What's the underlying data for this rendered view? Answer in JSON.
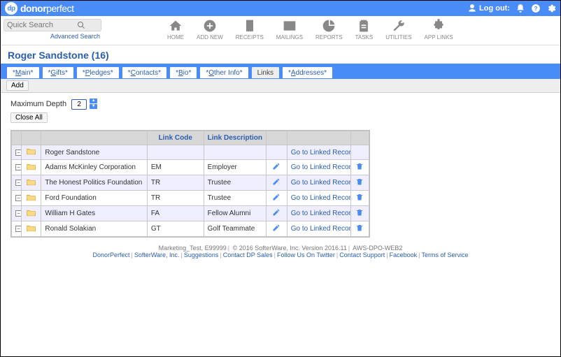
{
  "brand": {
    "badge": "dp",
    "name_part1": "donor",
    "name_part2": "perfect"
  },
  "header": {
    "logout_label": "Log out:"
  },
  "search": {
    "placeholder": "Quick Search",
    "advanced": "Advanced Search"
  },
  "nav": [
    {
      "label": "HOME"
    },
    {
      "label": "ADD NEW"
    },
    {
      "label": "RECEIPTS"
    },
    {
      "label": "MAILINGS"
    },
    {
      "label": "REPORTS"
    },
    {
      "label": "TASKS"
    },
    {
      "label": "UTILITIES"
    },
    {
      "label": "APP LINKS"
    }
  ],
  "donor": {
    "title": "Roger Sandstone (16)"
  },
  "tabs": [
    {
      "label": "*Main*"
    },
    {
      "label": "*Gifts*"
    },
    {
      "label": "*Pledges*"
    },
    {
      "label": "*Contacts*"
    },
    {
      "label": "*Bio*"
    },
    {
      "label": "*Other Info*"
    },
    {
      "label": "Links",
      "active": true
    },
    {
      "label": "*Addresses*"
    }
  ],
  "subbar": {
    "add": "Add"
  },
  "depth": {
    "label": "Maximum Depth",
    "value": "2",
    "close_all": "Close All"
  },
  "table": {
    "headers": {
      "code": "Link Code",
      "desc": "Link Description"
    },
    "go_label": "Go to Linked Record",
    "rows": [
      {
        "toggle": "−",
        "name": "Roger Sandstone",
        "code": "",
        "desc": "",
        "go": true,
        "edit": false,
        "del": false
      },
      {
        "toggle": "−",
        "name": "Adams McKinley Corporation",
        "code": "EM",
        "desc": "Employer",
        "go": true,
        "edit": true,
        "del": true
      },
      {
        "toggle": "−",
        "name": "The Honest Politics Foundation",
        "code": "TR",
        "desc": "Trustee",
        "go": true,
        "edit": true,
        "del": true
      },
      {
        "toggle": "−",
        "name": "Ford Foundation",
        "code": "TR",
        "desc": "Trustee",
        "go": true,
        "edit": true,
        "del": true
      },
      {
        "toggle": "−",
        "name": "William H Gates",
        "code": "FA",
        "desc": "Fellow Alumni",
        "go": true,
        "edit": true,
        "del": true
      },
      {
        "toggle": "−",
        "name": "Ronald Solakian",
        "code": "GT",
        "desc": "Golf Teammate",
        "go": true,
        "edit": true,
        "del": true
      }
    ]
  },
  "footer": {
    "line1_a": "Marketing_Test, E99999",
    "line1_b": "© 2016 SofterWare, Inc. Version 2016.11",
    "line1_c": "AWS-DPO-WEB2",
    "links": [
      "DonorPerfect",
      "SofterWare, Inc.",
      "Suggestions",
      "Contact DP Sales",
      "Follow Us On Twitter",
      "Contact Support",
      "Facebook",
      "Terms of Service"
    ]
  }
}
